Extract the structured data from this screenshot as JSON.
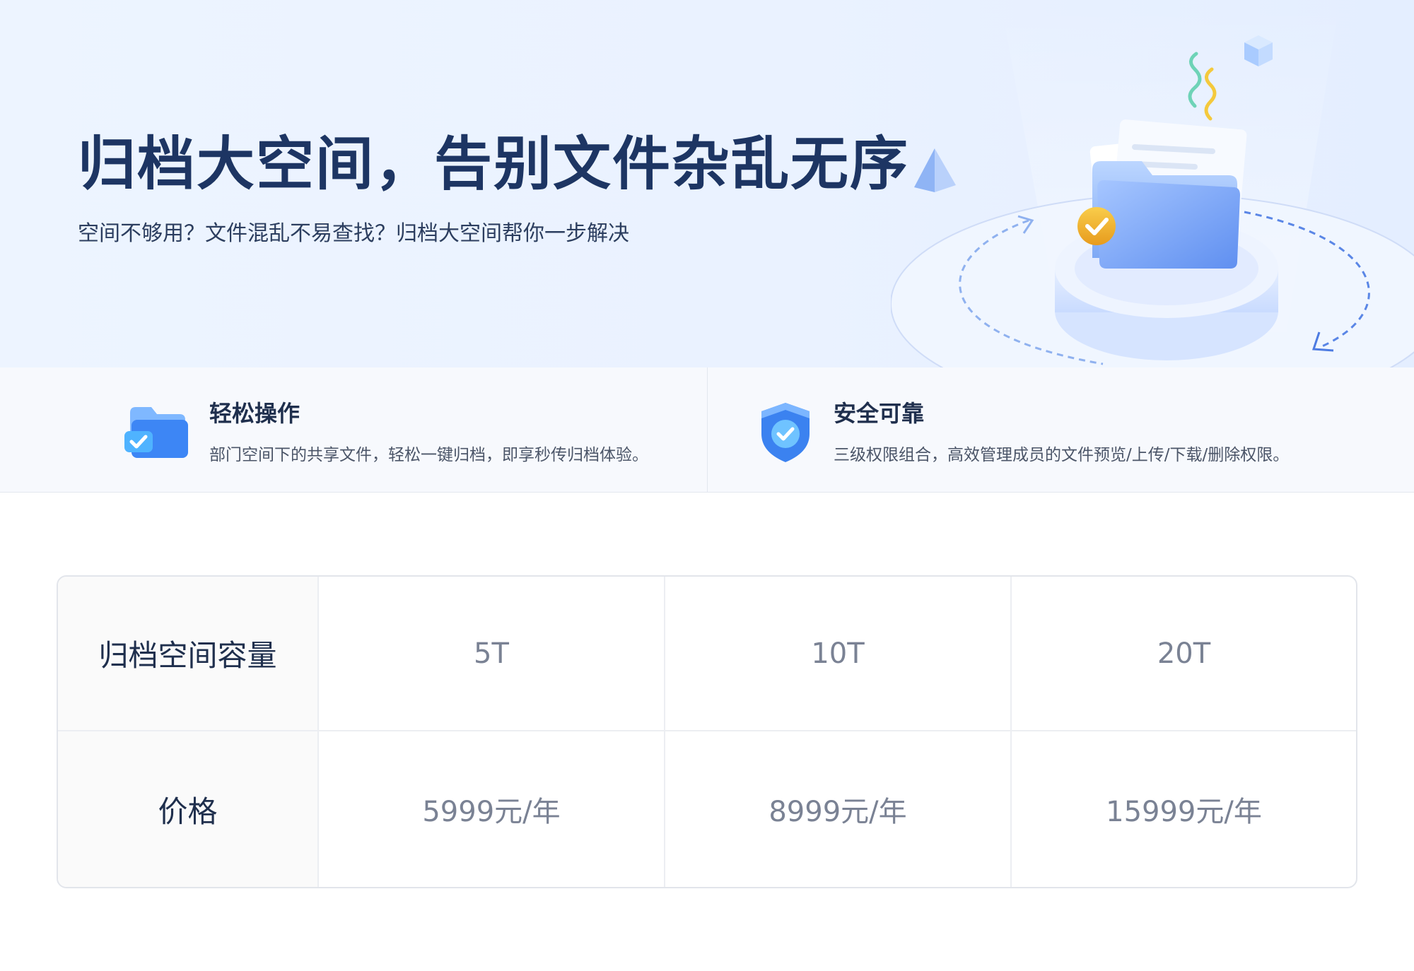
{
  "hero": {
    "title": "归档大空间，告别文件杂乱无序",
    "subtitle": "空间不够用？文件混乱不易查找？归档大空间帮你一步解决"
  },
  "features": [
    {
      "icon": "folder-check-icon",
      "title": "轻松操作",
      "description": "部门空间下的共享文件，轻松一键归档，即享秒传归档体验。"
    },
    {
      "icon": "shield-check-icon",
      "title": "安全可靠",
      "description": "三级权限组合，高效管理成员的文件预览/上传/下载/删除权限。"
    }
  ],
  "pricing": {
    "rows": [
      {
        "label": "归档空间容量",
        "values": [
          "5T",
          "10T",
          "20T"
        ]
      },
      {
        "label": "价格",
        "values": [
          "5999元/年",
          "8999元/年",
          "15999元/年"
        ]
      }
    ]
  },
  "colors": {
    "hero_bg": "#eaf2ff",
    "title": "#1d3563",
    "accent_blue": "#4a86f0",
    "check_gold": "#f0b429"
  }
}
